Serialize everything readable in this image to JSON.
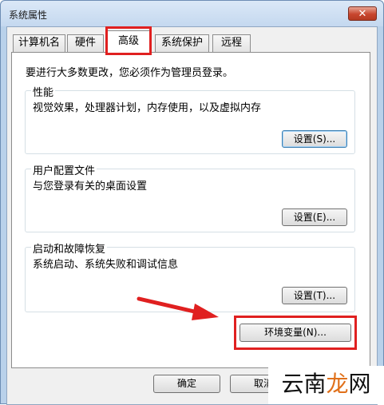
{
  "window": {
    "title": "系统属性",
    "close_label": "✕"
  },
  "tabs": [
    {
      "label": "计算机名"
    },
    {
      "label": "硬件"
    },
    {
      "label": "高级"
    },
    {
      "label": "系统保护"
    },
    {
      "label": "远程"
    }
  ],
  "notice": "要进行大多数更改，您必须作为管理员登录。",
  "groups": {
    "performance": {
      "title": "性能",
      "desc": "视觉效果，处理器计划，内存使用，以及虚拟内存",
      "button": "设置(S)..."
    },
    "profiles": {
      "title": "用户配置文件",
      "desc": "与您登录有关的桌面设置",
      "button": "设置(E)..."
    },
    "startup": {
      "title": "启动和故障恢复",
      "desc": "系统启动、系统失败和调试信息",
      "button": "设置(T)..."
    }
  },
  "env_button": "环境变量(N)...",
  "footer": {
    "ok": "确定",
    "cancel": "取消"
  },
  "watermark": {
    "part1": "云南",
    "part2": "龙",
    "part3": "网"
  },
  "colors": {
    "highlight": "#e02020",
    "titlebar": "#c4d8ef",
    "close": "#c8462e"
  }
}
